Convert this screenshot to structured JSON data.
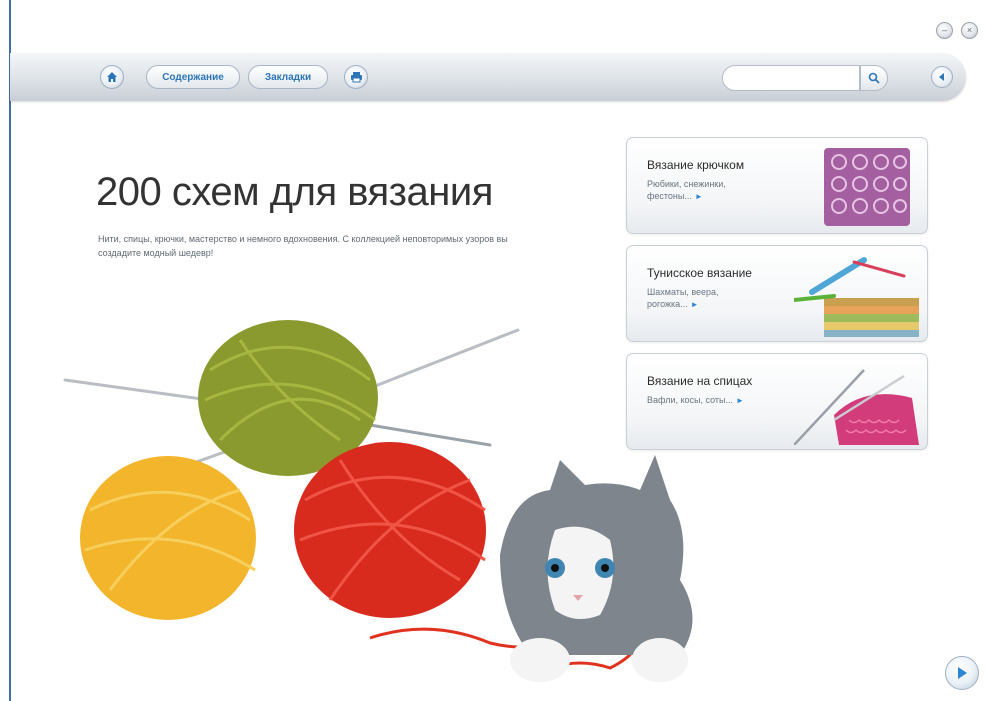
{
  "toolbar": {
    "contents_label": "Содержание",
    "bookmarks_label": "Закладки",
    "search_placeholder": "",
    "icons": [
      "home-icon",
      "print-icon",
      "search-icon",
      "back-arrow-icon"
    ]
  },
  "window": {
    "icons": [
      "minimize-icon",
      "close-icon"
    ]
  },
  "main": {
    "title": "200 схем для вязания",
    "subtitle": "Нити, спицы, крючки, мастерство и немного вдохновения. С коллекцией неповторимых узоров вы создадите модный шедевр!"
  },
  "categories": [
    {
      "title": "Вязание крючком",
      "desc": "Рюбики, снежинки, фестоны...",
      "arrow": "►"
    },
    {
      "title": "Тунисское вязание",
      "desc": "Шахматы, веера, рогожка...",
      "arrow": "►"
    },
    {
      "title": "Вязание на спицах",
      "desc": "Вафли, косы, соты...",
      "arrow": "►"
    }
  ],
  "colors": {
    "accent": "#2c76b8",
    "yarn_green": "#8a9a2e",
    "yarn_yellow": "#f2b52b",
    "yarn_red": "#d92a1e"
  }
}
